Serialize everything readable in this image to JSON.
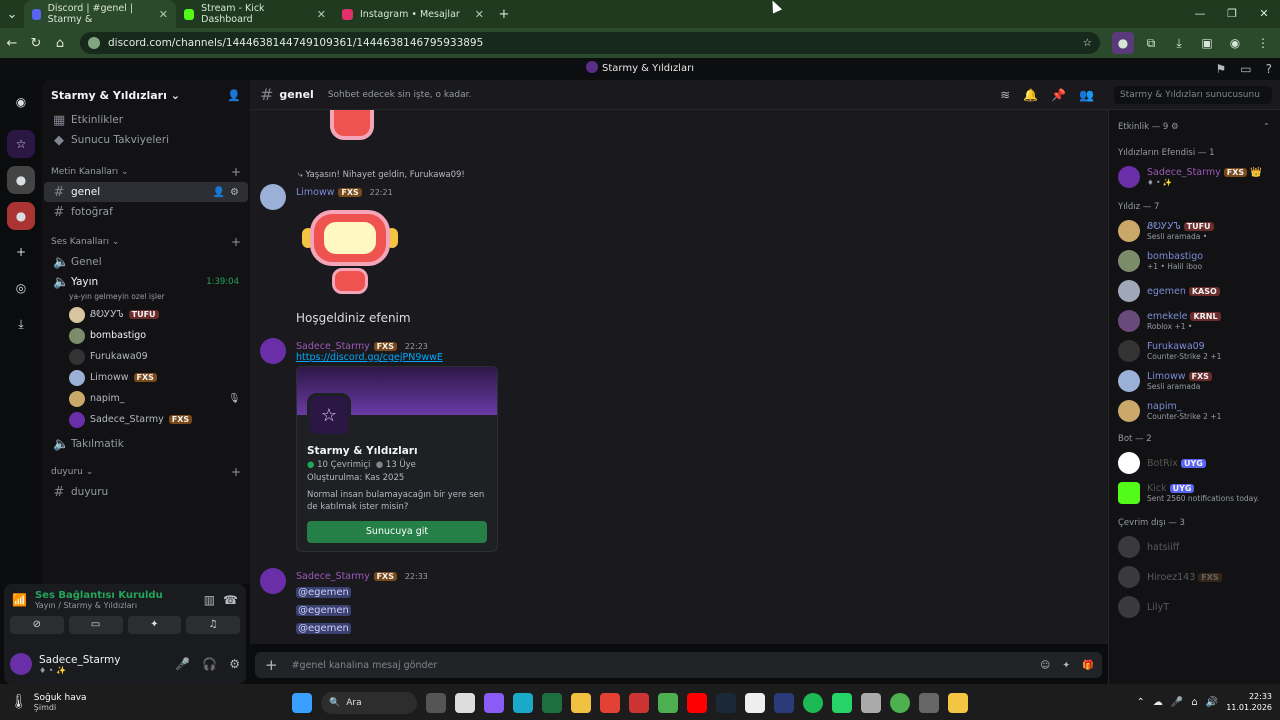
{
  "browser": {
    "tabs": [
      {
        "title": "Discord | #genel | Starmy &",
        "color": "#5865f2",
        "active": true
      },
      {
        "title": "Stream - Kick Dashboard",
        "color": "#53fc18",
        "active": false
      },
      {
        "title": "Instagram • Mesajlar",
        "color": "#e1306c",
        "active": false
      }
    ],
    "url": "discord.com/channels/1444638144749109361/1444638146795933895",
    "new_tab": "+",
    "icons": [
      "back-icon",
      "reload-icon",
      "home-icon",
      "star-icon",
      "extension-icon",
      "download-icon",
      "menu-icon"
    ]
  },
  "discord_title": "Starmy & Yıldızları",
  "server": {
    "name": "Starmy & Yıldızları",
    "items": [
      {
        "label": "Etkinlikler",
        "icon": "calendar-icon"
      },
      {
        "label": "Sunucu Takviyeleri",
        "icon": "boost-icon"
      }
    ],
    "categories": {
      "text": "Metin Kanalları",
      "voice": "Ses Kanalları",
      "duyuru": "duyuru"
    },
    "text_channels": [
      {
        "label": "genel",
        "active": true
      },
      {
        "label": "fotoğraf",
        "active": false
      }
    ],
    "voice_channels": [
      {
        "label": "Genel"
      },
      {
        "label": "Yayın",
        "time": "1:39:04",
        "sub": "ya-yın gelmeyin ozel işler"
      }
    ],
    "voice_users": [
      {
        "name": "ᏰᎧᎩᎩᏖ",
        "tag": "TUFU",
        "color": "#d9c5a0"
      },
      {
        "name": "bombastigo",
        "tag": "",
        "color": "#7a8c6a"
      },
      {
        "name": "Furukawa09",
        "tag": "",
        "color": "#333"
      },
      {
        "name": "Limoww",
        "tag": "FXS",
        "color": "#9bb0d6"
      },
      {
        "name": "napim_",
        "tag": "",
        "color": "#c9a86a"
      },
      {
        "name": "Sadece_Starmy",
        "tag": "FXS",
        "color": "#6a2fa8"
      }
    ],
    "takilmatik": "Takılmatik",
    "duyuru_channel": "duyuru"
  },
  "voice_panel": {
    "title": "Ses Bağlantısı Kuruldu",
    "sub": "Yayın / Starmy & Yıldızları"
  },
  "user_panel": {
    "name": "Sadece_Starmy",
    "status": "♦ • ✨"
  },
  "chat": {
    "channel": "genel",
    "topic": "Sohbet edecek sin işte, o kadar.",
    "search_placeholder": "Starmy & Yıldızları sunucusunu ara",
    "reply_text": "Yaşasın! Nihayet geldin, Furukawa09!",
    "msg1": {
      "author": "Limoww",
      "tag": "FXS",
      "time": "22:21"
    },
    "welcome": "Hoşgeldiniz efenim",
    "msg2": {
      "author": "Sadece_Starmy",
      "tag": "FXS",
      "time": "22:23",
      "link": "https://discord.gg/cgejPN9wwE"
    },
    "invite": {
      "title": "Starmy & Yıldızları",
      "online": "10 Çevrimiçi",
      "members": "13 Üye",
      "created": "Oluşturulma: Kas 2025",
      "desc": "Normal insan bulamayacağın bir yere sen de katılmak ister misin?",
      "button": "Sunucuya git"
    },
    "msg3": {
      "author": "Sadece_Starmy",
      "tag": "FXS",
      "time": "22:33",
      "mentions": [
        "@egemen",
        "@egemen",
        "@egemen"
      ]
    },
    "composer_placeholder": "#genel kanalına mesaj gönder"
  },
  "members": {
    "activity": "Etkinlik — 9",
    "admin_group": "Yıldızların Efendisi — 1",
    "admin": {
      "name": "Sadece_Starmy",
      "tag": "FXS",
      "status": "♦ • ✨"
    },
    "group2": "Yıldız — 7",
    "list": [
      {
        "name": "ᏰᎧᎩᎩᏖ",
        "tag": "TUFU",
        "status": "Sesli aramada •",
        "color": "#c9a86a"
      },
      {
        "name": "bombastigo",
        "tag": "",
        "status": "+1 • Halil iboo",
        "color": "#7a8c6a"
      },
      {
        "name": "egemen",
        "tag": "KASO",
        "status": "",
        "color": "#a0a8b8"
      },
      {
        "name": "emekele",
        "tag": "KRNL",
        "status": "Roblox +1 •",
        "color": "#6a4a7a"
      },
      {
        "name": "Furukawa09",
        "tag": "",
        "status": "Counter-Strike 2 +1",
        "color": "#333"
      },
      {
        "name": "Limoww",
        "tag": "FXS",
        "status": "Sesli aramada",
        "color": "#9bb0d6"
      },
      {
        "name": "napim_",
        "tag": "",
        "status": "Counter-Strike 2 +1",
        "color": "#c9a86a"
      }
    ],
    "bot_group": "Bot — 2",
    "bots": [
      {
        "name": "BotRix",
        "tag": "UYG",
        "status": "",
        "color": "#fff"
      },
      {
        "name": "Kick",
        "tag": "UYG",
        "status": "Sent 2560 notifications today.",
        "color": "#53fc18"
      }
    ],
    "offline_group": "Çevrim dışı — 3",
    "offline": [
      {
        "name": "hatsiiff",
        "tag": ""
      },
      {
        "name": "Hiroez143",
        "tag": "FXS"
      },
      {
        "name": "LilyT",
        "tag": ""
      }
    ]
  },
  "taskbar": {
    "weather_title": "Soğuk hava",
    "weather_sub": "Şimdi",
    "search": "Ara",
    "time": "22:33",
    "date": "11.01.2026"
  }
}
